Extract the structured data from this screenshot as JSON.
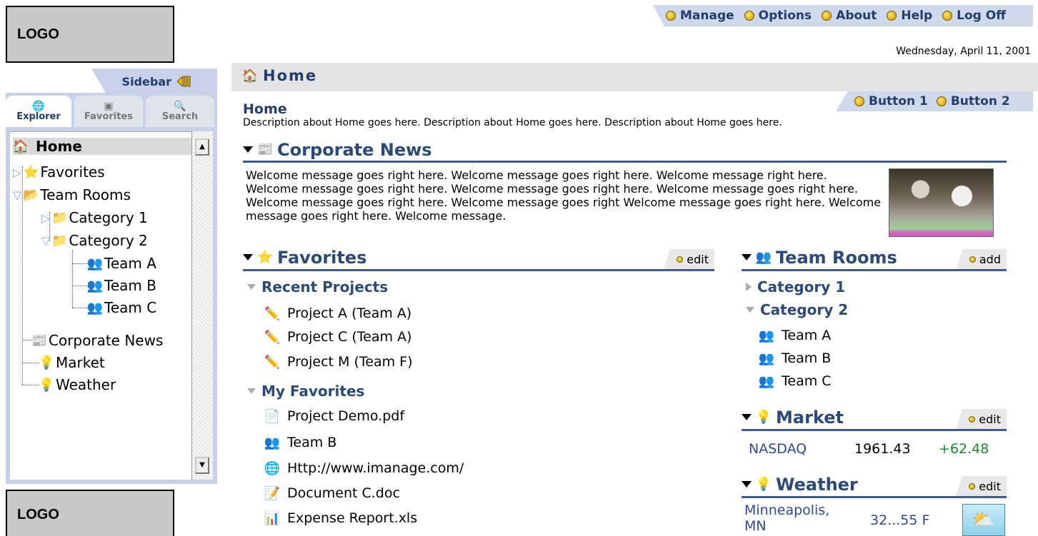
{
  "logo_top": "LOGO",
  "logo_bottom": "LOGO",
  "topnav": [
    "Manage",
    "Options",
    "About",
    "Help",
    "Log Off"
  ],
  "date": "Wednesday, April 11, 2001",
  "sidebar": {
    "label": "Sidebar",
    "tabs": [
      {
        "label": "Explorer",
        "icon": "globe-icon"
      },
      {
        "label": "Favorites",
        "icon": "folder-icon"
      },
      {
        "label": "Search",
        "icon": "magnifier-icon"
      }
    ],
    "tree": {
      "home": "Home",
      "favorites": "Favorites",
      "team_rooms": "Team Rooms",
      "category1": "Category 1",
      "category2": "Category 2",
      "team_a": "Team A",
      "team_b": "Team B",
      "team_c": "Team C",
      "corporate_news": "Corporate News",
      "market": "Market",
      "weather": "Weather"
    }
  },
  "header": {
    "title": "Home",
    "buttons": [
      "Button 1",
      "Button 2"
    ]
  },
  "page": {
    "title": "Home",
    "description": "Description about Home goes here.  Description about Home goes here.  Description about Home goes here."
  },
  "corporate_news": {
    "title": "Corporate News",
    "welcome": "Welcome message goes right here. Welcome message goes right here. Welcome message right here.  Welcome message goes right here.  Welcome message goes right here.  Welcome message goes right here. Welcome message goes right here. Welcome message goes right Welcome message goes right here. Welcome message goes right here. Welcome message."
  },
  "favorites": {
    "title": "Favorites",
    "edit": "edit",
    "recent_label": "Recent Projects",
    "recent": [
      "Project A  (Team A)",
      "Project C  (Team A)",
      "Project M  (Team F)"
    ],
    "my_label": "My Favorites",
    "my": [
      "Project Demo.pdf",
      "Team B",
      "Http://www.imanage.com/",
      "Document C.doc",
      "Expense Report.xls"
    ]
  },
  "team_rooms": {
    "title": "Team Rooms",
    "add": "add",
    "category1": "Category 1",
    "category2": "Category 2",
    "teams": [
      "Team A",
      "Team B",
      "Team C"
    ]
  },
  "market": {
    "title": "Market",
    "edit": "edit",
    "symbol": "NASDAQ",
    "value": "1961.43",
    "change": "+62.48"
  },
  "weather": {
    "title": "Weather",
    "edit": "edit",
    "city": "Minneapolis, MN",
    "range": "32...55 F"
  },
  "colors": {
    "navy": "#223e70",
    "accent_band": "#cfd9ec",
    "positive": "#1a8a2a"
  }
}
